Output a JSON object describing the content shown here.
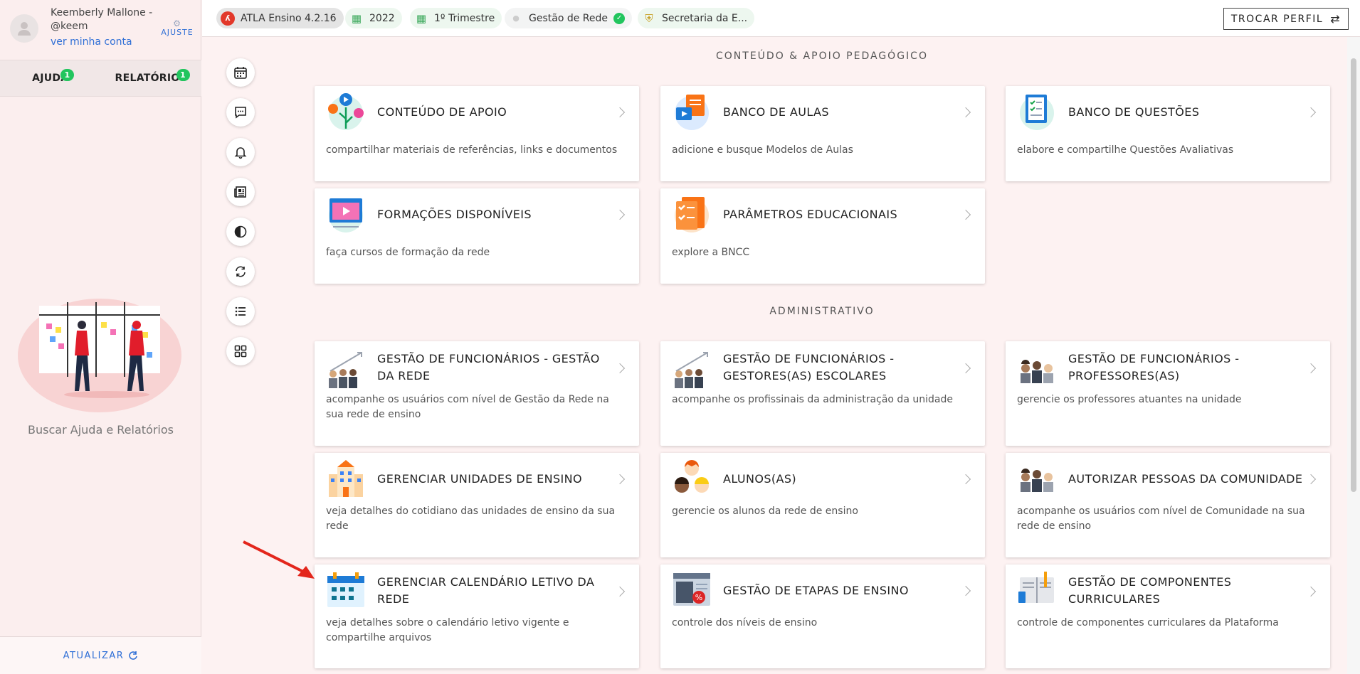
{
  "user": {
    "name": "Keemberly Mallone - @keem",
    "account_link": "ver minha conta",
    "settings_label": "AJUSTE"
  },
  "sidebar_tabs": [
    {
      "label": "AJUDA",
      "badge": "1"
    },
    {
      "label": "RELATÓRIOS",
      "badge": "1"
    }
  ],
  "help_text": "Buscar Ajuda e Relatórios",
  "update_label": "ATUALIZAR",
  "topbar": {
    "chips": [
      {
        "label": "ATLA Ensino 4.2.16",
        "icon": "atla-logo-icon"
      },
      {
        "label": "2022",
        "icon": "calendar-icon"
      },
      {
        "label": "1º Trimestre",
        "icon": "calendar-icon"
      },
      {
        "label": "Gestão de Rede",
        "icon": "user-icon"
      },
      {
        "label": "Secretaria da E...",
        "icon": "crest-icon"
      }
    ],
    "switch_profile": "TROCAR PERFIL"
  },
  "rail_icons": [
    "calendar-icon",
    "chat-icon",
    "bell-icon",
    "newspaper-icon",
    "contrast-icon",
    "sync-icon",
    "list-icon",
    "grid-icon"
  ],
  "sections": {
    "pedagogico": "CONTEÚDO & APOIO PEDAGÓGICO",
    "administrativo": "ADMINISTRATIVO"
  },
  "cards": [
    {
      "title": "CONTEÚDO DE APOIO",
      "desc": "compartilhar materiais de referências, links e documentos"
    },
    {
      "title": "BANCO DE AULAS",
      "desc": "adicione e busque Modelos de Aulas"
    },
    {
      "title": "BANCO DE QUESTÕES",
      "desc": "elabore e compartilhe Questões Avaliativas"
    },
    {
      "title": "FORMAÇÕES DISPONÍVEIS",
      "desc": "faça cursos de formação da rede"
    },
    {
      "title": "PARÂMETROS EDUCACIONAIS",
      "desc": "explore a BNCC"
    },
    {
      "title": "GESTÃO DE FUNCIONÁRIOS - GESTÃO DA REDE",
      "desc": "acompanhe os usuários com nível de Gestão da Rede na sua rede de ensino"
    },
    {
      "title": "GESTÃO DE FUNCIONÁRIOS - GESTORES(AS) ESCOLARES",
      "desc": "acompanhe os profissinais da administração da unidade"
    },
    {
      "title": "GESTÃO DE FUNCIONÁRIOS - PROFESSORES(AS)",
      "desc": "gerencie os professores atuantes na unidade"
    },
    {
      "title": "GERENCIAR UNIDADES DE ENSINO",
      "desc": "veja detalhes do cotidiano das unidades de ensino da sua rede"
    },
    {
      "title": "ALUNOS(AS)",
      "desc": "gerencie os alunos da rede de ensino"
    },
    {
      "title": "AUTORIZAR PESSOAS DA COMUNIDADE",
      "desc": "acompanhe os usuários com nível de Comunidade na sua rede de ensino"
    },
    {
      "title": "GERENCIAR CALENDÁRIO LETIVO DA REDE",
      "desc": "veja detalhes sobre o calendário letivo vigente e compartilhe arquivos"
    },
    {
      "title": "GESTÃO DE ETAPAS DE ENSINO",
      "desc": "controle dos níveis de ensino"
    },
    {
      "title": "GESTÃO DE COMPONENTES CURRICULARES",
      "desc": "controle de componentes curriculares da Plataforma"
    }
  ]
}
